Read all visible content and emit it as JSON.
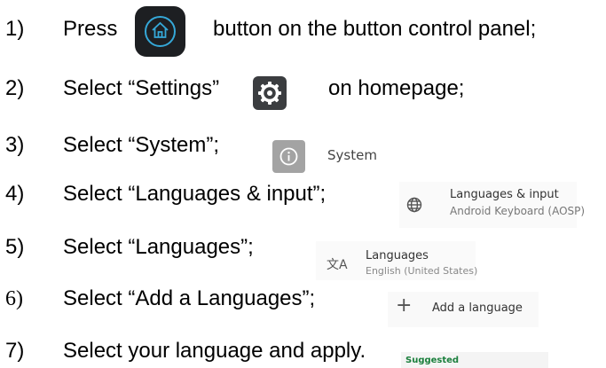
{
  "steps": [
    {
      "num": "1)",
      "text": "Press",
      "text_after": "button on the button control panel;"
    },
    {
      "num": "2)",
      "text": "Select “Settings”",
      "text_after": "on homepage;"
    },
    {
      "num": "3)",
      "text": "Select “System”;"
    },
    {
      "num": "4)",
      "text": "Select “Languages & input”;"
    },
    {
      "num": "5)",
      "text": "Select “Languages”;"
    },
    {
      "num": "6)",
      "text": "Select “Add a Languages”;"
    },
    {
      "num": "7)",
      "text": "Select your language and apply."
    }
  ],
  "screens": {
    "system": {
      "label": "System",
      "icon": "info-icon"
    },
    "languages_input": {
      "title": "Languages & input",
      "subtitle": "Android Keyboard (AOSP)",
      "icon": "globe-icon"
    },
    "languages": {
      "title": "Languages",
      "subtitle": "English (United States)",
      "icon": "translate-icon",
      "glyph": "文A"
    },
    "add_language": {
      "label": "Add a language",
      "icon": "plus-icon",
      "glyph": "+"
    },
    "suggested": {
      "label": "Suggested"
    }
  },
  "icons": {
    "home_button": "home-icon",
    "settings": "gear-icon"
  },
  "colors": {
    "home_accent": "#35a8d8",
    "suggested": "#1a7f3c"
  }
}
